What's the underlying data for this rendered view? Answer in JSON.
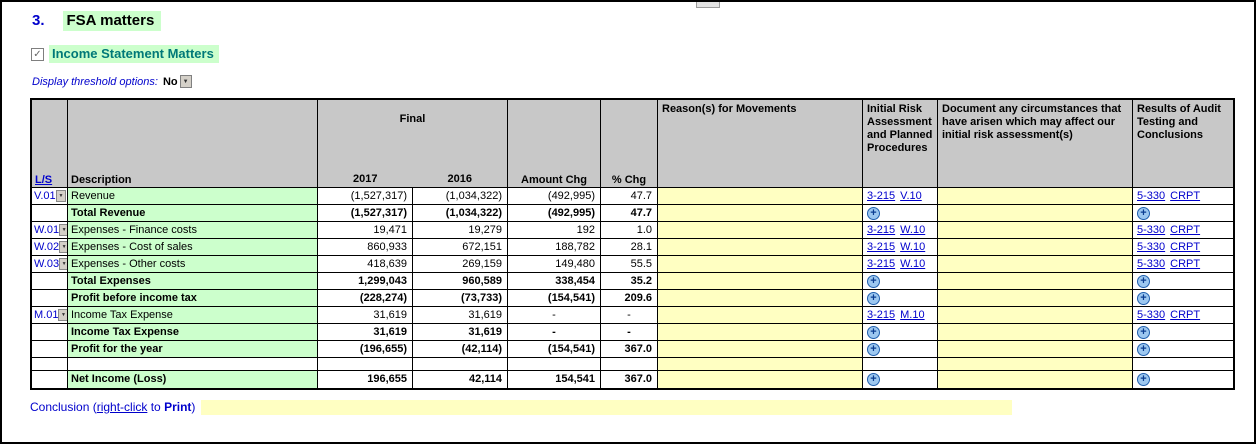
{
  "page": {
    "section_number": "3.",
    "section_title": "FSA matters",
    "subsection_title": "Income Statement Matters",
    "threshold_label": "Display threshold options:",
    "threshold_value": "No"
  },
  "icons": {
    "dropdown_arrow": "▼",
    "plus_icon": "+",
    "checkbox_check": "✓"
  },
  "colors": {
    "green_highlight": "#ccffcc",
    "yellow_input": "#ffffc2",
    "header_gray": "#c8c8c8",
    "link_blue": "#0000cc",
    "subtitle_teal": "#007878"
  },
  "table": {
    "headers": {
      "ls": "L/S",
      "description": "Description",
      "final_group": "Final",
      "col_2017": "2017",
      "col_2016": "2016",
      "amount_chg": "Amount Chg",
      "pct_chg": "% Chg",
      "reasons": "Reason(s) for Movements",
      "initial_risk": "Initial Risk Assessment and Planned Procedures",
      "circumstances": "Document any circumstances that have arisen which may affect our initial risk assessment(s)",
      "results": "Results of Audit Testing and Conclusions"
    },
    "rows": [
      {
        "ls": "V.01",
        "description": "Revenue",
        "bold": false,
        "y2017": "(1,527,317)",
        "y2016": "(1,034,322)",
        "amount_chg": "(492,995)",
        "pct_chg": "47.7",
        "risk_links": [
          "3-215",
          "V.10"
        ],
        "results_links": [
          "5-330",
          "CRPT"
        ]
      },
      {
        "ls": "",
        "description": "Total Revenue",
        "bold": true,
        "y2017": "(1,527,317)",
        "y2016": "(1,034,322)",
        "amount_chg": "(492,995)",
        "pct_chg": "47.7",
        "risk_plus": true,
        "results_plus": true
      },
      {
        "ls": "W.01",
        "description": "Expenses - Finance costs",
        "bold": false,
        "y2017": "19,471",
        "y2016": "19,279",
        "amount_chg": "192",
        "pct_chg": "1.0",
        "risk_links": [
          "3-215",
          "W.10"
        ],
        "results_links": [
          "5-330",
          "CRPT"
        ]
      },
      {
        "ls": "W.02",
        "description": "Expenses - Cost of sales",
        "bold": false,
        "y2017": "860,933",
        "y2016": "672,151",
        "amount_chg": "188,782",
        "pct_chg": "28.1",
        "risk_links": [
          "3-215",
          "W.10"
        ],
        "results_links": [
          "5-330",
          "CRPT"
        ]
      },
      {
        "ls": "W.03",
        "description": "Expenses - Other costs",
        "bold": false,
        "y2017": "418,639",
        "y2016": "269,159",
        "amount_chg": "149,480",
        "pct_chg": "55.5",
        "risk_links": [
          "3-215",
          "W.10"
        ],
        "results_links": [
          "5-330",
          "CRPT"
        ]
      },
      {
        "ls": "",
        "description": "Total Expenses",
        "bold": true,
        "y2017": "1,299,043",
        "y2016": "960,589",
        "amount_chg": "338,454",
        "pct_chg": "35.2",
        "risk_plus": true,
        "results_plus": true
      },
      {
        "ls": "",
        "description": "Profit before income tax",
        "bold": true,
        "y2017": "(228,274)",
        "y2016": "(73,733)",
        "amount_chg": "(154,541)",
        "pct_chg": "209.6",
        "risk_plus": true,
        "results_plus": true
      },
      {
        "ls": "M.01",
        "description": "Income Tax Expense",
        "bold": false,
        "y2017": "31,619",
        "y2016": "31,619",
        "amount_chg": "-",
        "pct_chg": "-",
        "risk_links": [
          "3-215",
          "M.10"
        ],
        "results_links": [
          "5-330",
          "CRPT"
        ]
      },
      {
        "ls": "",
        "description": "Income Tax Expense",
        "bold": true,
        "y2017": "31,619",
        "y2016": "31,619",
        "amount_chg": "-",
        "pct_chg": "-",
        "risk_plus": true,
        "results_plus": true
      },
      {
        "ls": "",
        "description": "Profit for the year",
        "bold": true,
        "y2017": "(196,655)",
        "y2016": "(42,114)",
        "amount_chg": "(154,541)",
        "pct_chg": "367.0",
        "risk_plus": true,
        "results_plus": true
      },
      {
        "empty": true
      },
      {
        "ls": "",
        "description": "Net Income (Loss)",
        "bold": true,
        "y2017": "196,655",
        "y2016": "42,114",
        "amount_chg": "154,541",
        "pct_chg": "367.0",
        "risk_plus": true,
        "results_plus": true
      }
    ]
  },
  "footer": {
    "conclusion_prefix": "Conclusion (",
    "conclusion_link": "right-click",
    "conclusion_mid": " to ",
    "conclusion_bold": "Print",
    "conclusion_suffix": ")"
  }
}
